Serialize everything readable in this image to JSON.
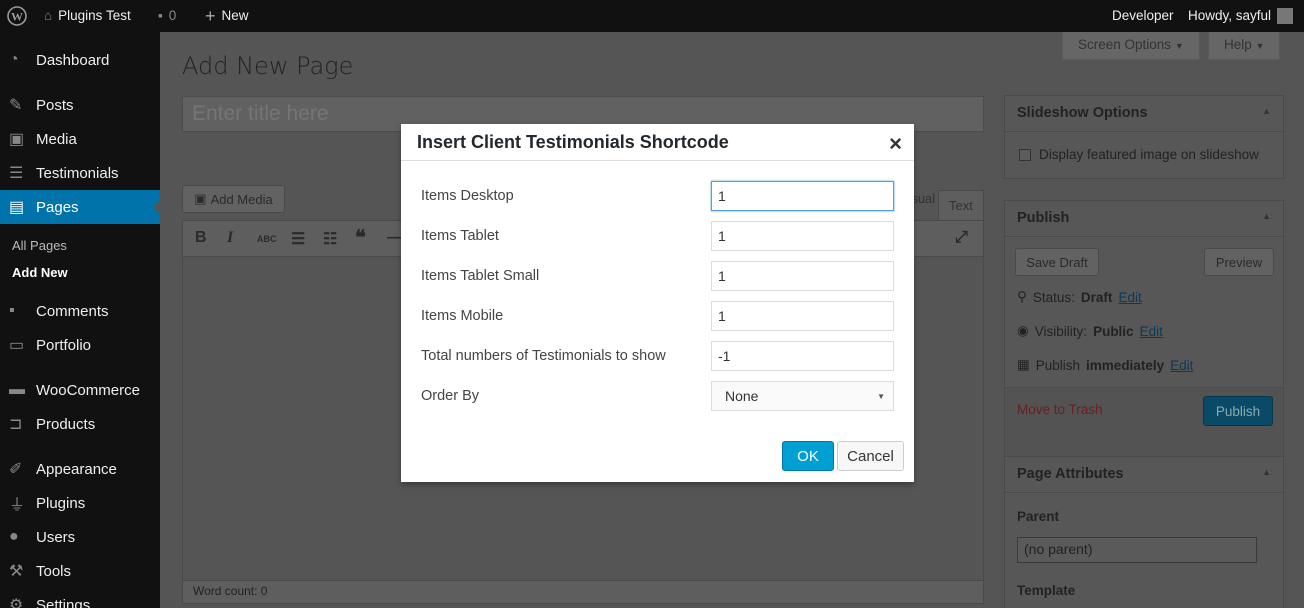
{
  "admin_bar": {
    "site_name": "Plugins Test",
    "comments_count": "0",
    "new_label": "New",
    "developer_label": "Developer",
    "howdy_label": "Howdy, sayful"
  },
  "sidebar": {
    "items": [
      {
        "label": "Dashboard",
        "icon": "dashboard-icon"
      },
      {
        "label": "Posts",
        "icon": "pin-icon"
      },
      {
        "label": "Media",
        "icon": "media-icon"
      },
      {
        "label": "Testimonials",
        "icon": "testimonial-icon"
      },
      {
        "label": "Pages",
        "icon": "pages-icon"
      },
      {
        "label": "Comments",
        "icon": "comment-icon"
      },
      {
        "label": "Portfolio",
        "icon": "folder-icon"
      },
      {
        "label": "WooCommerce",
        "icon": "woo-icon"
      },
      {
        "label": "Products",
        "icon": "cart-icon"
      },
      {
        "label": "Appearance",
        "icon": "brush-icon"
      },
      {
        "label": "Plugins",
        "icon": "plug-icon"
      },
      {
        "label": "Users",
        "icon": "user-icon"
      },
      {
        "label": "Tools",
        "icon": "wrench-icon"
      },
      {
        "label": "Settings",
        "icon": "settings-icon"
      }
    ],
    "submenu": [
      "All Pages",
      "Add New"
    ]
  },
  "screen_options_label": "Screen Options",
  "help_label": "Help",
  "page_title": "Add New Page",
  "title_placeholder": "Enter title here",
  "add_media_label": "Add Media",
  "visual_tab": "Visual",
  "text_tab": "Text",
  "word_count": "Word count: 0",
  "slideshow": {
    "title": "Slideshow Options",
    "checkbox_label": "Display featured image on slideshow"
  },
  "publish": {
    "title": "Publish",
    "save_draft": "Save Draft",
    "preview": "Preview",
    "status_label": "Status:",
    "status_value": "Draft",
    "visibility_label": "Visibility:",
    "visibility_value": "Public",
    "publish_label": "Publish",
    "publish_value": "immediately",
    "edit": "Edit",
    "trash": "Move to Trash",
    "publish_button": "Publish"
  },
  "attributes": {
    "title": "Page Attributes",
    "parent_label": "Parent",
    "parent_value": "(no parent)",
    "template_label": "Template"
  },
  "modal": {
    "title": "Insert Client Testimonials Shortcode",
    "fields": [
      {
        "label": "Items Desktop",
        "value": "1"
      },
      {
        "label": "Items Tablet",
        "value": "1"
      },
      {
        "label": "Items Tablet Small",
        "value": "1"
      },
      {
        "label": "Items Mobile",
        "value": "1"
      },
      {
        "label": "Total numbers of Testimonials to show",
        "value": "-1"
      }
    ],
    "order_by_label": "Order By",
    "order_by_value": "None",
    "ok": "OK",
    "cancel": "Cancel"
  }
}
